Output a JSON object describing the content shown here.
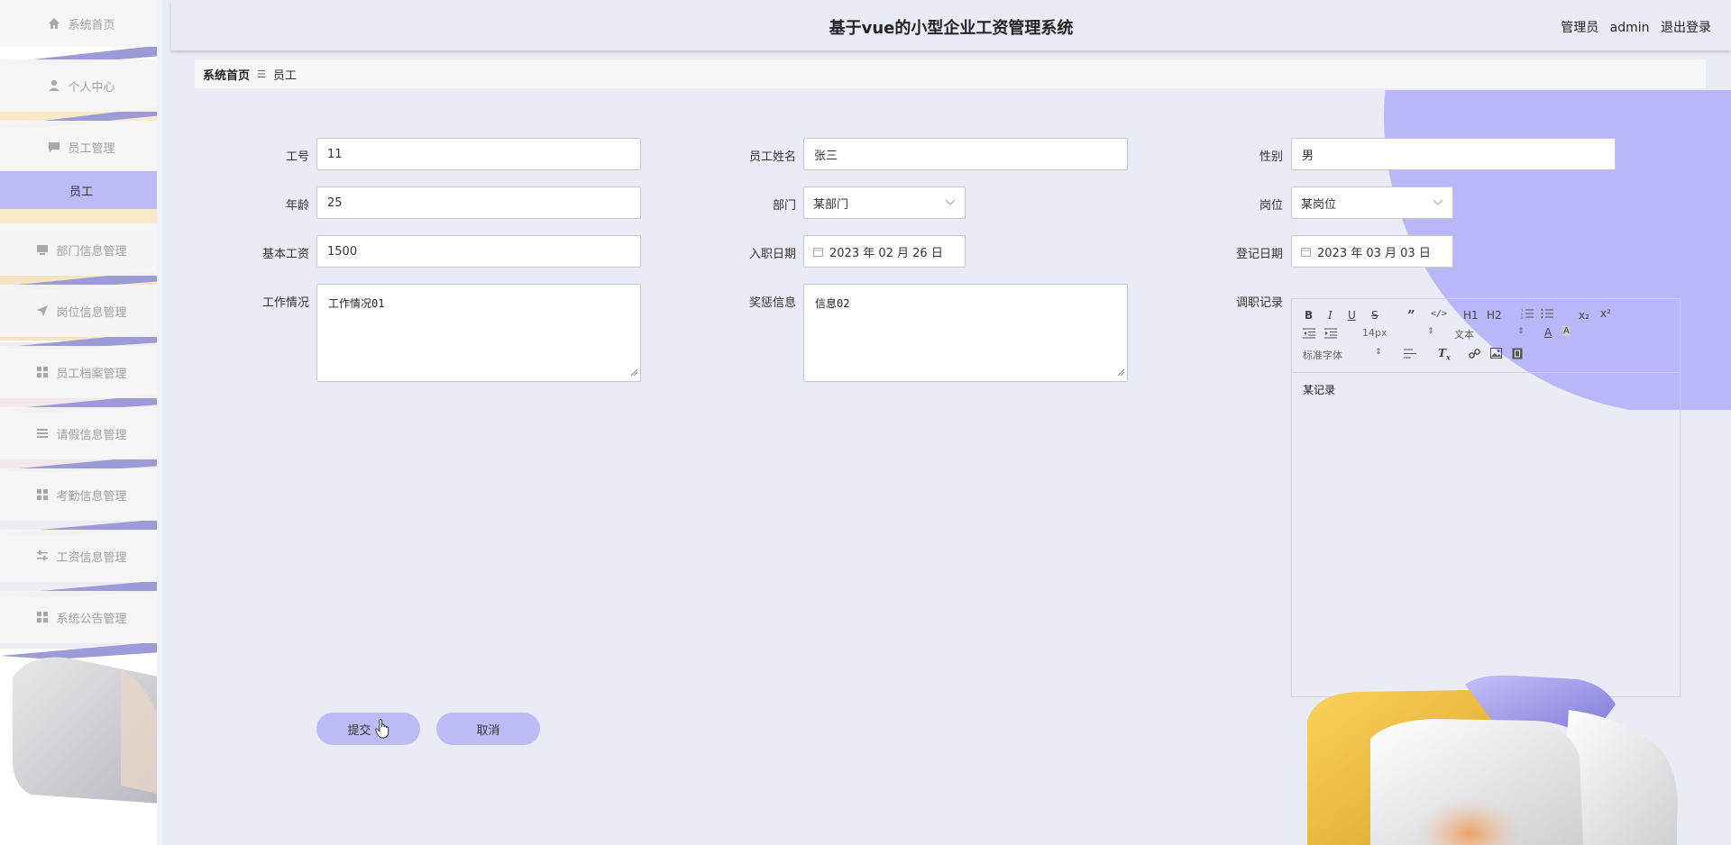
{
  "header": {
    "title": "基于vue的小型企业工资管理系统",
    "role": "管理员",
    "username": "admin",
    "logout_label": "退出登录"
  },
  "sidebar": {
    "items": [
      {
        "label": "系统首页",
        "icon": "home-icon"
      },
      {
        "label": "个人中心",
        "icon": "user-icon"
      },
      {
        "label": "员工管理",
        "icon": "chat-icon"
      },
      {
        "label": "部门信息管理",
        "icon": "monitor-icon"
      },
      {
        "label": "岗位信息管理",
        "icon": "send-icon"
      },
      {
        "label": "员工档案管理",
        "icon": "grid-icon"
      },
      {
        "label": "请假信息管理",
        "icon": "list-icon"
      },
      {
        "label": "考勤信息管理",
        "icon": "grid-icon"
      },
      {
        "label": "工资信息管理",
        "icon": "sliders-icon"
      },
      {
        "label": "系统公告管理",
        "icon": "grid-icon"
      }
    ],
    "sub_item": "员工"
  },
  "breadcrumb": {
    "home": "系统首页",
    "current": "员工"
  },
  "form": {
    "employee_id": {
      "label": "工号",
      "value": "11"
    },
    "employee_name": {
      "label": "员工姓名",
      "value": "张三"
    },
    "gender": {
      "label": "性别",
      "value": "男"
    },
    "age": {
      "label": "年龄",
      "value": "25"
    },
    "department": {
      "label": "部门",
      "value": "某部门"
    },
    "position": {
      "label": "岗位",
      "value": "某岗位"
    },
    "base_salary": {
      "label": "基本工资",
      "value": "1500"
    },
    "hire_date": {
      "label": "入职日期",
      "value": "2023 年 02 月 26 日"
    },
    "register_date": {
      "label": "登记日期",
      "value": "2023 年 03 月 03 日"
    },
    "work_status": {
      "label": "工作情况",
      "value": "工作情况01"
    },
    "rewards": {
      "label": "奖惩信息",
      "value": "信息02"
    },
    "transfer_record": {
      "label": "调职记录",
      "value": "某记录"
    }
  },
  "editor": {
    "font_size": "14px",
    "text_type": "文本",
    "font_family": "标准字体",
    "h1": "H1",
    "h2": "H2",
    "sub": "x₂",
    "sup": "x²"
  },
  "buttons": {
    "submit": "提交",
    "cancel": "取消"
  },
  "colors": {
    "accent": "#bdbbf5",
    "background": "#e9ecf5",
    "circle": "#b9b6fa"
  }
}
